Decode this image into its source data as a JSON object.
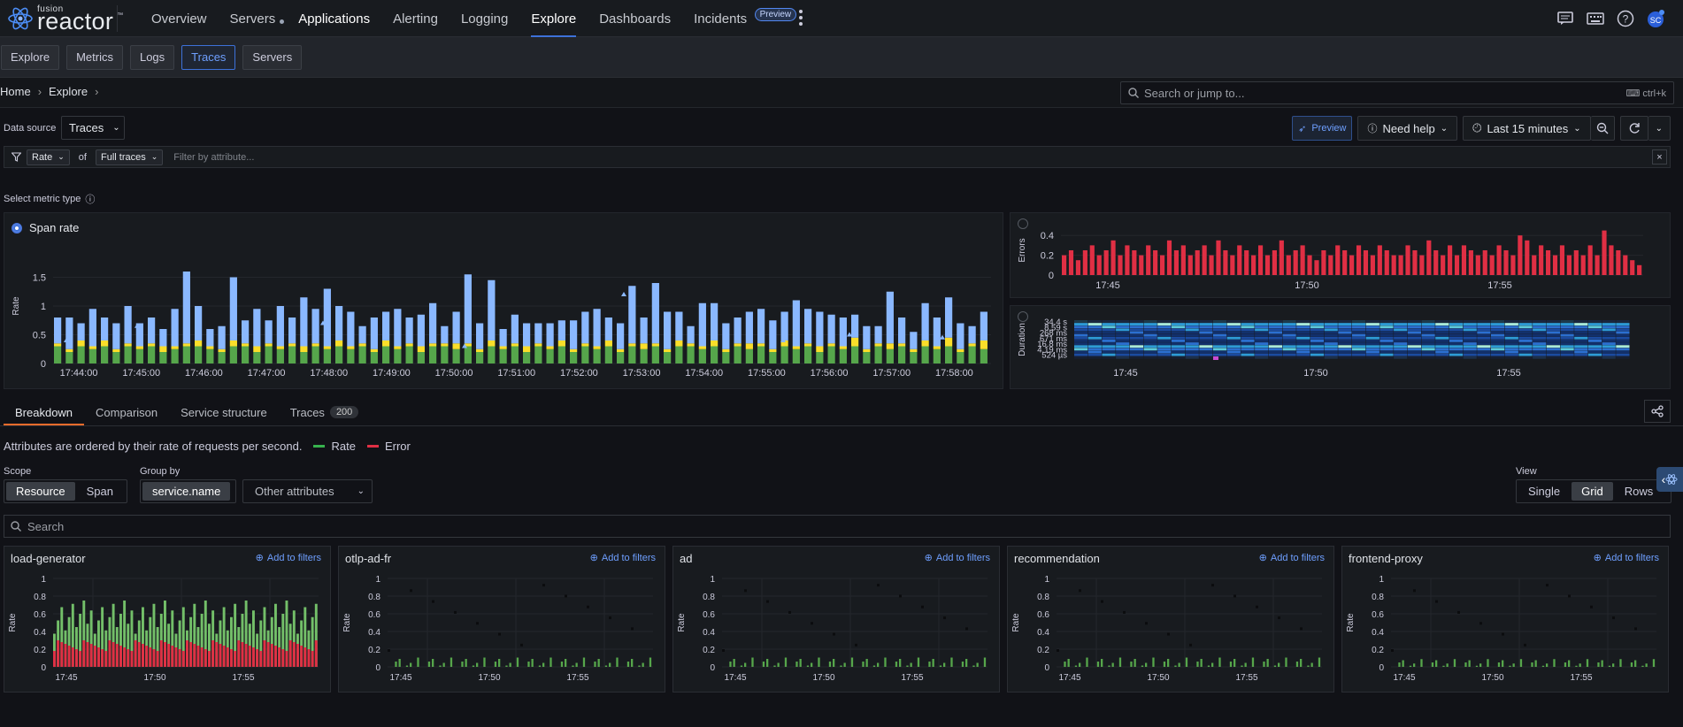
{
  "app": {
    "logo_small": "fusion",
    "logo_big": "reactor",
    "logo_tm": "™"
  },
  "nav": [
    "Overview",
    "Servers",
    "Applications",
    "Alerting",
    "Logging",
    "Explore",
    "Dashboards",
    "Incidents"
  ],
  "nav_active": "Explore",
  "nav_badge": "Preview",
  "topbar_icons": [
    "chat-icon",
    "keyboard-icon",
    "help-icon",
    "avatar"
  ],
  "subnav": [
    "Explore",
    "Metrics",
    "Logs",
    "Traces",
    "Servers"
  ],
  "subnav_active": "Traces",
  "breadcrumb": [
    "Home",
    "Explore"
  ],
  "search_top": {
    "placeholder": "Search or jump to...",
    "shortcut": "ctrl+k"
  },
  "datasource": {
    "label": "Data source",
    "value": "Traces"
  },
  "toolbar": {
    "preview": "Preview",
    "need_help": "Need help",
    "time_range": "Last 15 minutes"
  },
  "filter": {
    "metric": "Rate",
    "of": "of",
    "scope": "Full traces",
    "placeholder": "Filter by attribute...",
    "close": "×"
  },
  "metric_type_label": "Select metric type",
  "span_rate": {
    "label": "Span rate",
    "ylabel": "Rate"
  },
  "errors_panel": {
    "ylabel": "Errors"
  },
  "duration_panel": {
    "ylabel": "Duration",
    "ticks": [
      "34.4 s",
      "8.59 s",
      "268 ms",
      "671 ms",
      "16.8 ms",
      "4.19 ms",
      "524 µs"
    ]
  },
  "tabs": [
    {
      "label": "Breakdown",
      "count": ""
    },
    {
      "label": "Comparison",
      "count": ""
    },
    {
      "label": "Service structure",
      "count": ""
    },
    {
      "label": "Traces",
      "count": "200"
    }
  ],
  "legend_text": "Attributes are ordered by their rate of requests per second.",
  "legend": [
    {
      "label": "Rate",
      "color": "#37b24d"
    },
    {
      "label": "Error",
      "color": "#e02f44"
    }
  ],
  "scope": {
    "label": "Scope",
    "options": [
      "Resource",
      "Span"
    ],
    "selected": "Resource"
  },
  "group_by": {
    "label": "Group by",
    "value": "service.name",
    "other": "Other attributes"
  },
  "view": {
    "label": "View",
    "options": [
      "Single",
      "Grid",
      "Rows"
    ],
    "selected": "Grid"
  },
  "grid_search": {
    "placeholder": "Search"
  },
  "add_to_filters": "Add to filters",
  "colors": {
    "rate_bar": "#8ab8ff",
    "rate_green": "#56a64b",
    "rate_yellow": "#fade2a",
    "error_red": "#e02f44",
    "accent": "#3d71d9"
  },
  "chart_data": [
    {
      "type": "bar",
      "name": "span-rate",
      "x": [
        "17:44:00",
        "17:45:00",
        "17:46:00",
        "17:47:00",
        "17:48:00",
        "17:49:00",
        "17:50:00",
        "17:51:00",
        "17:52:00",
        "17:53:00",
        "17:54:00",
        "17:55:00",
        "17:56:00",
        "17:57:00",
        "17:58:00"
      ],
      "xlabel_ticks": [
        "17:44:00",
        "17:45:00",
        "17:46:00",
        "17:47:00",
        "17:48:00",
        "17:49:00",
        "17:50:00",
        "17:51:00",
        "17:52:00",
        "17:53:00",
        "17:54:00",
        "17:55:00",
        "17:56:00",
        "17:57:00",
        "17:58:00"
      ],
      "ylabel": "Rate",
      "yticks": [
        0,
        0.5,
        1,
        1.5
      ],
      "ylim": [
        0,
        2
      ],
      "series": [
        {
          "color": "#56a64b",
          "values": [
            0.3,
            0.2,
            0.3,
            0.25,
            0.3,
            0.2,
            0.3,
            0.25,
            0.3,
            0.2,
            0.25,
            0.3,
            0.3,
            0.25,
            0.2,
            0.3,
            0.3,
            0.2,
            0.3,
            0.25,
            0.3,
            0.2,
            0.3,
            0.25,
            0.3,
            0.25,
            0.3,
            0.2,
            0.3,
            0.25,
            0.3,
            0.2,
            0.3,
            0.3,
            0.25,
            0.3,
            0.2,
            0.3,
            0.25,
            0.3,
            0.2,
            0.3,
            0.25,
            0.3,
            0.2,
            0.3,
            0.25,
            0.3,
            0.2,
            0.3,
            0.25,
            0.3,
            0.2,
            0.3,
            0.3,
            0.25,
            0.3,
            0.2,
            0.3,
            0.25,
            0.3,
            0.2,
            0.3,
            0.25,
            0.3,
            0.2,
            0.3,
            0.25,
            0.3,
            0.2,
            0.3,
            0.25,
            0.3,
            0.2,
            0.3,
            0.25,
            0.3,
            0.2,
            0.3,
            0.25
          ]
        },
        {
          "color": "#fade2a",
          "values": [
            0.05,
            0.05,
            0.1,
            0.05,
            0.1,
            0.05,
            0.05,
            0.05,
            0.05,
            0.1,
            0.05,
            0.05,
            0.1,
            0.05,
            0.05,
            0.1,
            0.05,
            0.1,
            0.05,
            0.05,
            0.05,
            0.1,
            0.05,
            0.05,
            0.1,
            0.05,
            0.05,
            0.05,
            0.1,
            0.05,
            0.05,
            0.1,
            0.05,
            0.05,
            0.1,
            0.05,
            0.05,
            0.1,
            0.05,
            0.05,
            0.1,
            0.05,
            0.05,
            0.1,
            0.05,
            0.05,
            0.05,
            0.1,
            0.05,
            0.05,
            0.1,
            0.05,
            0.05,
            0.1,
            0.05,
            0.05,
            0.1,
            0.05,
            0.05,
            0.1,
            0.05,
            0.05,
            0.1,
            0.05,
            0.05,
            0.1,
            0.05,
            0.05,
            0.15,
            0.05,
            0.05,
            0.1,
            0.05,
            0.05,
            0.1,
            0.05,
            0.15,
            0.05,
            0.05,
            0.15
          ]
        },
        {
          "color": "#8ab8ff",
          "values": [
            0.45,
            0.55,
            0.3,
            0.65,
            0.4,
            0.45,
            0.65,
            0.4,
            0.45,
            0.3,
            0.65,
            1.25,
            0.6,
            0.3,
            0.4,
            1.1,
            0.4,
            0.65,
            0.4,
            0.7,
            0.45,
            0.85,
            0.6,
            1.0,
            0.6,
            0.6,
            0.3,
            0.55,
            0.5,
            0.65,
            0.45,
            0.55,
            0.7,
            0.3,
            0.55,
            1.2,
            0.45,
            1.05,
            0.3,
            0.5,
            0.4,
            0.35,
            0.4,
            0.35,
            0.5,
            0.55,
            0.65,
            0.4,
            0.45,
            1.0,
            0.45,
            1.05,
            0.65,
            0.5,
            0.3,
            0.75,
            0.65,
            0.45,
            0.45,
            0.55,
            0.6,
            0.5,
            0.5,
            0.8,
            0.6,
            0.6,
            0.5,
            0.5,
            0.4,
            0.4,
            0.3,
            0.9,
            0.45,
            0.3,
            0.65,
            0.5,
            0.7,
            0.45,
            0.3,
            0.5
          ]
        }
      ]
    },
    {
      "type": "bar",
      "name": "errors",
      "xlabel_ticks": [
        "17:45",
        "17:50",
        "17:55"
      ],
      "ylabel": "Errors",
      "yticks": [
        0,
        0.2,
        0.4
      ],
      "ylim": [
        0,
        0.5
      ],
      "values": [
        0.2,
        0.25,
        0.15,
        0.25,
        0.3,
        0.2,
        0.25,
        0.35,
        0.2,
        0.3,
        0.25,
        0.2,
        0.3,
        0.25,
        0.2,
        0.35,
        0.25,
        0.3,
        0.2,
        0.25,
        0.3,
        0.2,
        0.35,
        0.25,
        0.2,
        0.3,
        0.25,
        0.2,
        0.3,
        0.2,
        0.25,
        0.35,
        0.2,
        0.25,
        0.3,
        0.2,
        0.15,
        0.25,
        0.2,
        0.3,
        0.25,
        0.2,
        0.3,
        0.25,
        0.2,
        0.3,
        0.25,
        0.2,
        0.2,
        0.3,
        0.25,
        0.2,
        0.35,
        0.25,
        0.2,
        0.3,
        0.2,
        0.3,
        0.25,
        0.2,
        0.25,
        0.2,
        0.3,
        0.25,
        0.2,
        0.4,
        0.35,
        0.2,
        0.3,
        0.25,
        0.2,
        0.3,
        0.2,
        0.25,
        0.2,
        0.3,
        0.2,
        0.45,
        0.3,
        0.25,
        0.2,
        0.15,
        0.1
      ]
    },
    {
      "type": "heatmap",
      "name": "duration",
      "xlabel_ticks": [
        "17:45",
        "17:50",
        "17:55"
      ],
      "ylabel": "Duration",
      "yticks": [
        "34.4 s",
        "8.59 s",
        "268 ms",
        "671 ms",
        "16.8 ms",
        "4.19 ms",
        "524 µs"
      ]
    },
    {
      "type": "bar",
      "name": "load-generator",
      "title": "load-generator",
      "ylabel": "Rate",
      "yticks": [
        0,
        0.2,
        0.4,
        0.6,
        0.8,
        1
      ],
      "xlabel_ticks": [
        "17:45",
        "17:50",
        "17:55"
      ],
      "rate_level": 0.75,
      "error_level": 0.3
    },
    {
      "type": "scatter",
      "name": "otlp-ad-fr",
      "title": "otlp-ad-fr",
      "ylabel": "Rate",
      "yticks": [
        0,
        0.2,
        0.4,
        0.6,
        0.8,
        1
      ],
      "xlabel_ticks": [
        "17:45",
        "17:50",
        "17:55"
      ],
      "rate_level": 0.12,
      "error_level": 0
    },
    {
      "type": "scatter",
      "name": "ad",
      "title": "ad",
      "ylabel": "Rate",
      "yticks": [
        0,
        0.2,
        0.4,
        0.6,
        0.8,
        1
      ],
      "xlabel_ticks": [
        "17:45",
        "17:50",
        "17:55"
      ],
      "rate_level": 0.12,
      "error_level": 0
    },
    {
      "type": "scatter",
      "name": "recommendation",
      "title": "recommendation",
      "ylabel": "Rate",
      "yticks": [
        0,
        0.2,
        0.4,
        0.6,
        0.8,
        1
      ],
      "xlabel_ticks": [
        "17:45",
        "17:50",
        "17:55"
      ],
      "rate_level": 0.12,
      "error_level": 0
    },
    {
      "type": "scatter",
      "name": "frontend-proxy",
      "title": "frontend-proxy",
      "ylabel": "Rate",
      "yticks": [
        0,
        0.2,
        0.4,
        0.6,
        0.8,
        1
      ],
      "xlabel_ticks": [
        "17:45",
        "17:50",
        "17:55"
      ],
      "rate_level": 0.1,
      "error_level": 0
    }
  ]
}
